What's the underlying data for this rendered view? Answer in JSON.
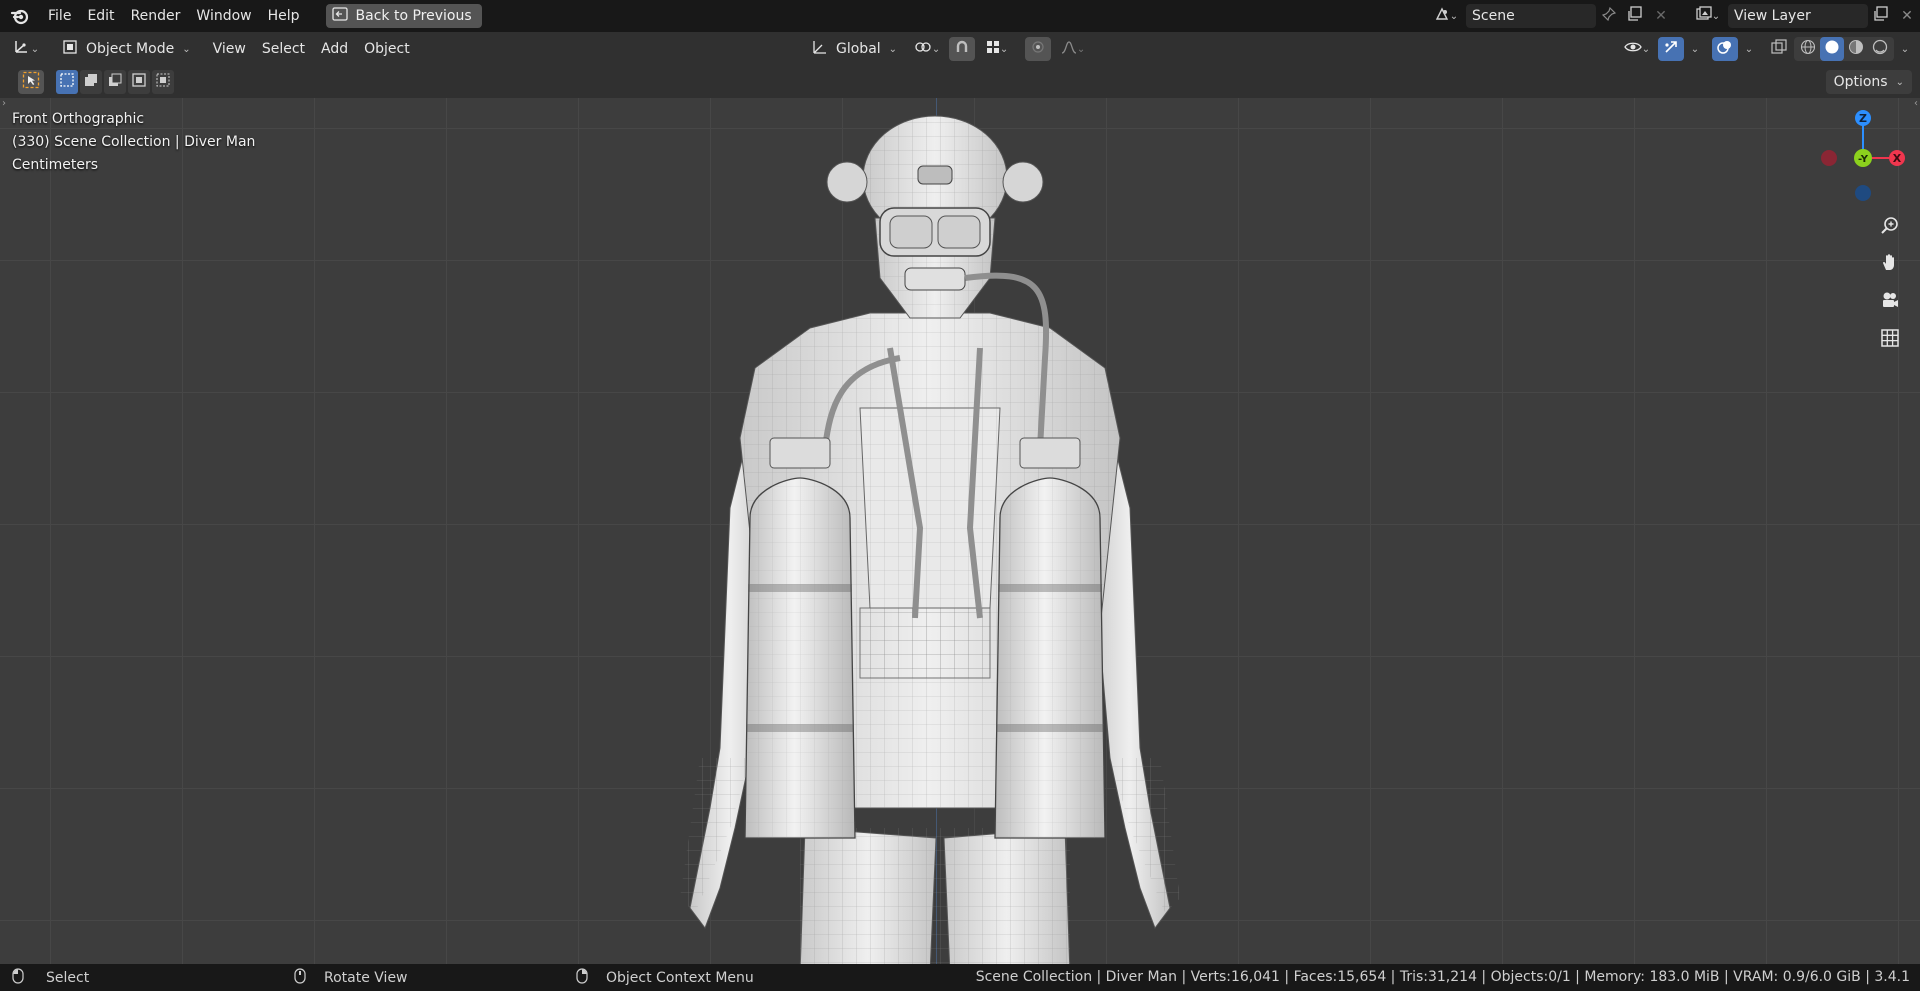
{
  "menubar": {
    "items": [
      "File",
      "Edit",
      "Render",
      "Window",
      "Help"
    ],
    "back_button": "Back to Previous",
    "scene_field": "Scene",
    "view_layer_field": "View Layer"
  },
  "header": {
    "editor_type_icon": "axes-icon",
    "mode": "Object Mode",
    "menus": [
      "View",
      "Select",
      "Add",
      "Object"
    ],
    "orientation": "Global",
    "accent_color": "#4772b3"
  },
  "toolbar": {
    "options_label": "Options"
  },
  "viewport": {
    "view_name": "Front Orthographic",
    "collection_line": "(330) Scene Collection | Diver Man",
    "units": "Centimeters",
    "gizmo": {
      "z": "Z",
      "y": "-Y",
      "x": "X"
    },
    "gizmo_colors": {
      "x": "#f0364e",
      "y": "#8cd11d",
      "z": "#2c8fff"
    }
  },
  "statusbar": {
    "select": "Select",
    "rotate": "Rotate View",
    "context_menu": "Object Context Menu",
    "stats": "Scene Collection | Diver Man  | Verts:16,041 | Faces:15,654 | Tris:31,214 | Objects:0/1 | Memory: 183.0 MiB | VRAM: 0.9/6.0 GiB | 3.4.1"
  }
}
